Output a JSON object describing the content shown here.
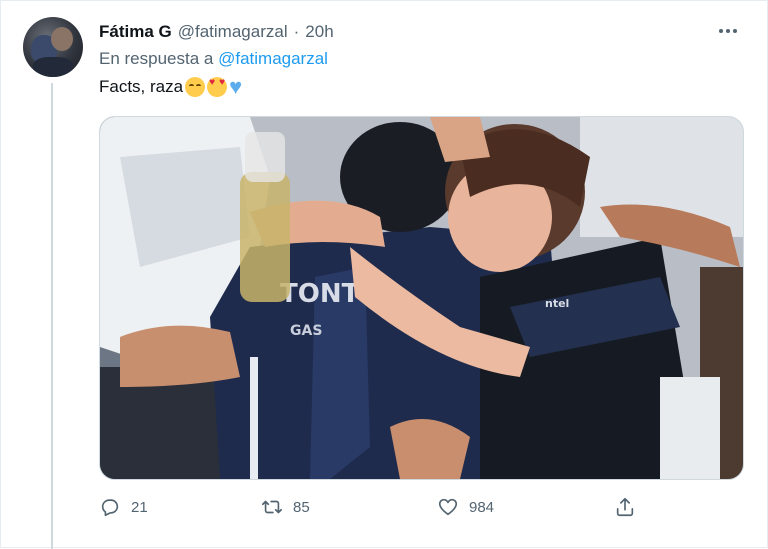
{
  "tweet": {
    "author_name": "Fátima G",
    "author_handle": "@fatimagarzal",
    "separator": "·",
    "time": "20h",
    "reply_prefix": "En respuesta a",
    "reply_mention": "@fatimagarzal",
    "text": "Facts, raza",
    "emojis": [
      "relieved-face",
      "smiling-face-with-heart-eyes",
      "blue-heart"
    ]
  },
  "actions": {
    "reply_count": "21",
    "retweet_count": "85",
    "like_count": "984",
    "reply_icon": "reply-icon",
    "retweet_icon": "retweet-icon",
    "like_icon": "heart-icon",
    "share_icon": "share-icon"
  },
  "media": {
    "jersey_text": "TONTE",
    "sponsor_text": "GAS",
    "sleeve_text": "ntel"
  },
  "colors": {
    "link": "#1d9bf0",
    "secondary_text": "#536471",
    "primary_text": "#0f1419"
  }
}
